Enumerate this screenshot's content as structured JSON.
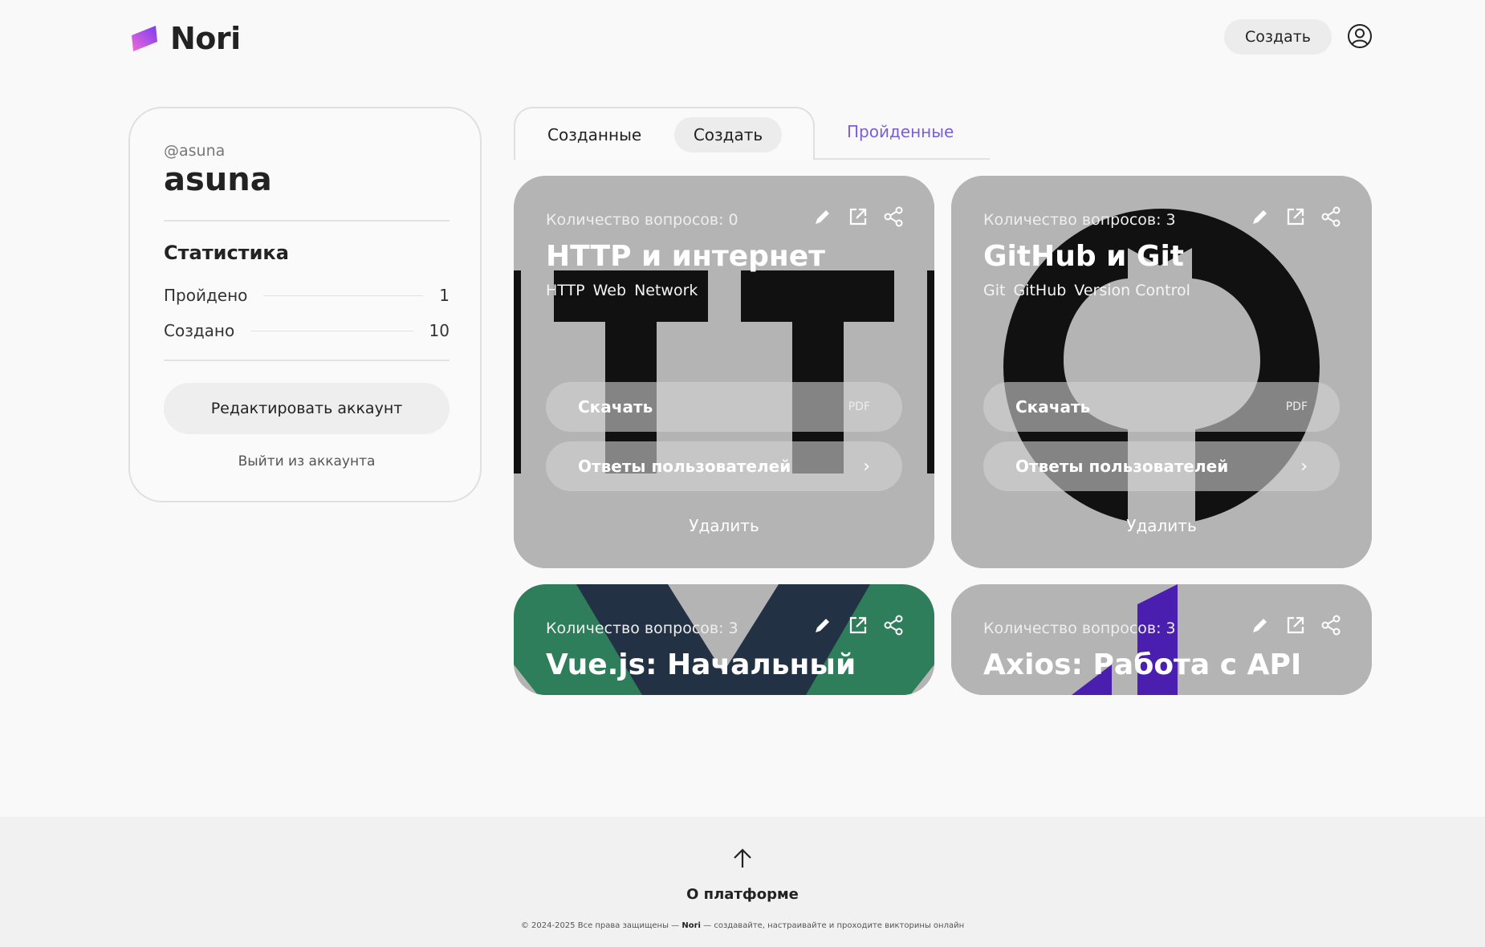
{
  "header": {
    "logo_text": "Nori",
    "create_label": "Создать"
  },
  "profile": {
    "handle": "@asuna",
    "username": "asuna",
    "stats_title": "Статистика",
    "stats": [
      {
        "label": "Пройдено",
        "value": "1"
      },
      {
        "label": "Создано",
        "value": "10"
      }
    ],
    "edit_label": "Редактировать аккаунт",
    "logout_label": "Выйти из аккаунта"
  },
  "tabs": {
    "created": "Созданные",
    "create": "Создать",
    "passed": "Пройденные"
  },
  "quizzes": [
    {
      "question_count": "Количество вопросов: 0",
      "title": "HTTP и интернет",
      "tags": [
        "HTTP",
        "Web",
        "Network"
      ],
      "download_label": "Скачать",
      "download_format": "PDF",
      "answers_label": "Ответы пользователей",
      "delete_label": "Удалить"
    },
    {
      "question_count": "Количество вопросов: 3",
      "title": "GitHub и Git",
      "tags": [
        "Git",
        "GitHub",
        "Version Control"
      ],
      "download_label": "Скачать",
      "download_format": "PDF",
      "answers_label": "Ответы пользователей",
      "delete_label": "Удалить"
    },
    {
      "question_count": "Количество вопросов: 3",
      "title": "Vue.js: Начальный"
    },
    {
      "question_count": "Количество вопросов: 3",
      "title": "Axios: Работа с API"
    }
  ],
  "footer": {
    "about_label": "О платформе",
    "copyright_prefix": "© 2024-2025 Все права защищены —",
    "copyright_brand": "Nori",
    "copyright_suffix": "— создавайте, настраивайте и проходите викторины онлайн"
  },
  "colors": {
    "accent": "#7b5ed6",
    "card_gray": "#b4b4b4",
    "vue_green": "#2e7d5b",
    "vue_navy": "#223144",
    "axios_purple": "#4a1fb0"
  }
}
